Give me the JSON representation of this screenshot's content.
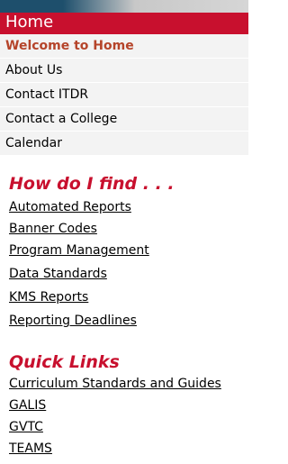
{
  "header": {
    "title": "Home"
  },
  "menu": {
    "items": [
      {
        "label": "Welcome to Home",
        "active": true
      },
      {
        "label": "About Us"
      },
      {
        "label": "Contact ITDR"
      },
      {
        "label": "Contact a College"
      },
      {
        "label": "Calendar"
      }
    ]
  },
  "how_do_i_find": {
    "title": "How do I find . . .",
    "links": [
      "Automated Reports",
      "Banner Codes",
      "Program Management",
      "Data Standards",
      "KMS Reports",
      "Reporting Deadlines"
    ]
  },
  "quick_links": {
    "title": "Quick Links",
    "links": [
      "Curriculum Standards and Guides",
      "GALIS",
      "GVTC",
      "TEAMS"
    ]
  },
  "colors": {
    "accent_red": "#c8102e",
    "active_text": "#b5442a",
    "header_blue": "#1e4f6c",
    "menu_bg": "#f3f3f3"
  }
}
